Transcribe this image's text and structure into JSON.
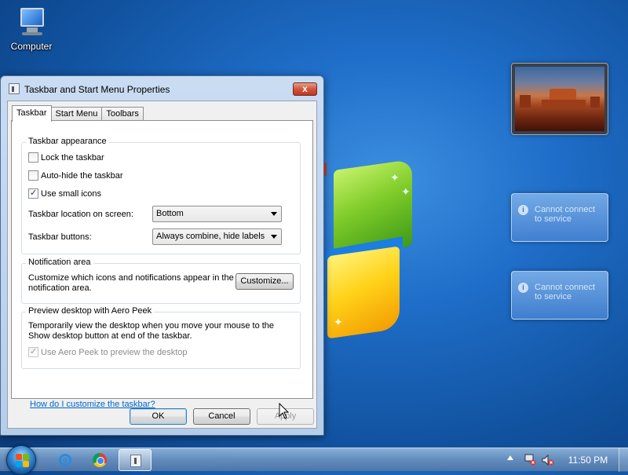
{
  "desktop": {
    "icons": [
      {
        "label": "Computer",
        "icon": "computer-icon"
      }
    ]
  },
  "gadgets": {
    "service_messages": [
      "Cannot connect to service",
      "Cannot connect to service"
    ]
  },
  "dialog": {
    "title": "Taskbar and Start Menu Properties",
    "close_label": "x",
    "tabs": [
      {
        "label": "Taskbar",
        "active": true
      },
      {
        "label": "Start Menu",
        "active": false
      },
      {
        "label": "Toolbars",
        "active": false
      }
    ],
    "appearance": {
      "group_title": "Taskbar appearance",
      "lock_label": "Lock the taskbar",
      "lock_checked": false,
      "autohide_label": "Auto-hide the taskbar",
      "autohide_checked": false,
      "small_icons_label": "Use small icons",
      "small_icons_checked": true,
      "location_label": "Taskbar location on screen:",
      "location_value": "Bottom",
      "buttons_label": "Taskbar buttons:",
      "buttons_value": "Always combine, hide labels"
    },
    "notification": {
      "group_title": "Notification area",
      "description": "Customize which icons and notifications appear in the notification area.",
      "customize_label": "Customize..."
    },
    "aero_peek": {
      "group_title": "Preview desktop with Aero Peek",
      "description": "Temporarily view the desktop when you move your mouse to the Show desktop button at end of the taskbar.",
      "use_label": "Use Aero Peek to preview the desktop",
      "use_checked": true,
      "use_enabled": false
    },
    "help_link": "How do I customize the taskbar?",
    "buttons": {
      "ok": "OK",
      "cancel": "Cancel",
      "apply": "Apply"
    }
  },
  "taskbar": {
    "pinned": [
      "internet-explorer-icon",
      "chrome-icon",
      "taskbar-properties-icon"
    ],
    "clock": "11:50 PM"
  }
}
